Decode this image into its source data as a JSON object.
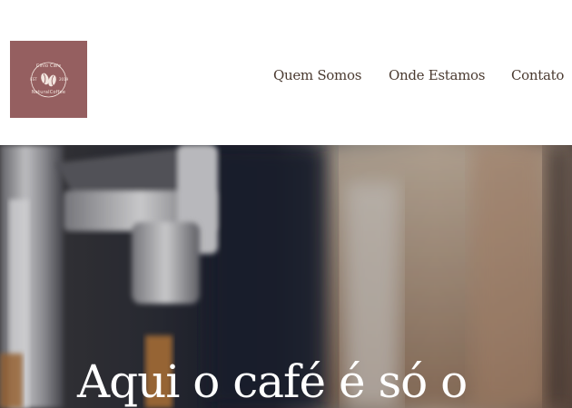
{
  "brand": {
    "name_top": "Cinlo Cafe",
    "name_bottom": "NaturalCoffee",
    "est_label": "EST",
    "year_label": "2019",
    "logo_bg": "#955f60",
    "logo_icon": "coffee-beans-icon"
  },
  "nav": {
    "items": [
      {
        "label": "Quem Somos"
      },
      {
        "label": "Onde Estamos"
      },
      {
        "label": "Contato"
      }
    ]
  },
  "hero": {
    "title": "Aqui o café é só o",
    "image": "espresso-machine-photo"
  },
  "colors": {
    "nav_text": "#4a3a30",
    "hero_text": "#ffffff"
  }
}
